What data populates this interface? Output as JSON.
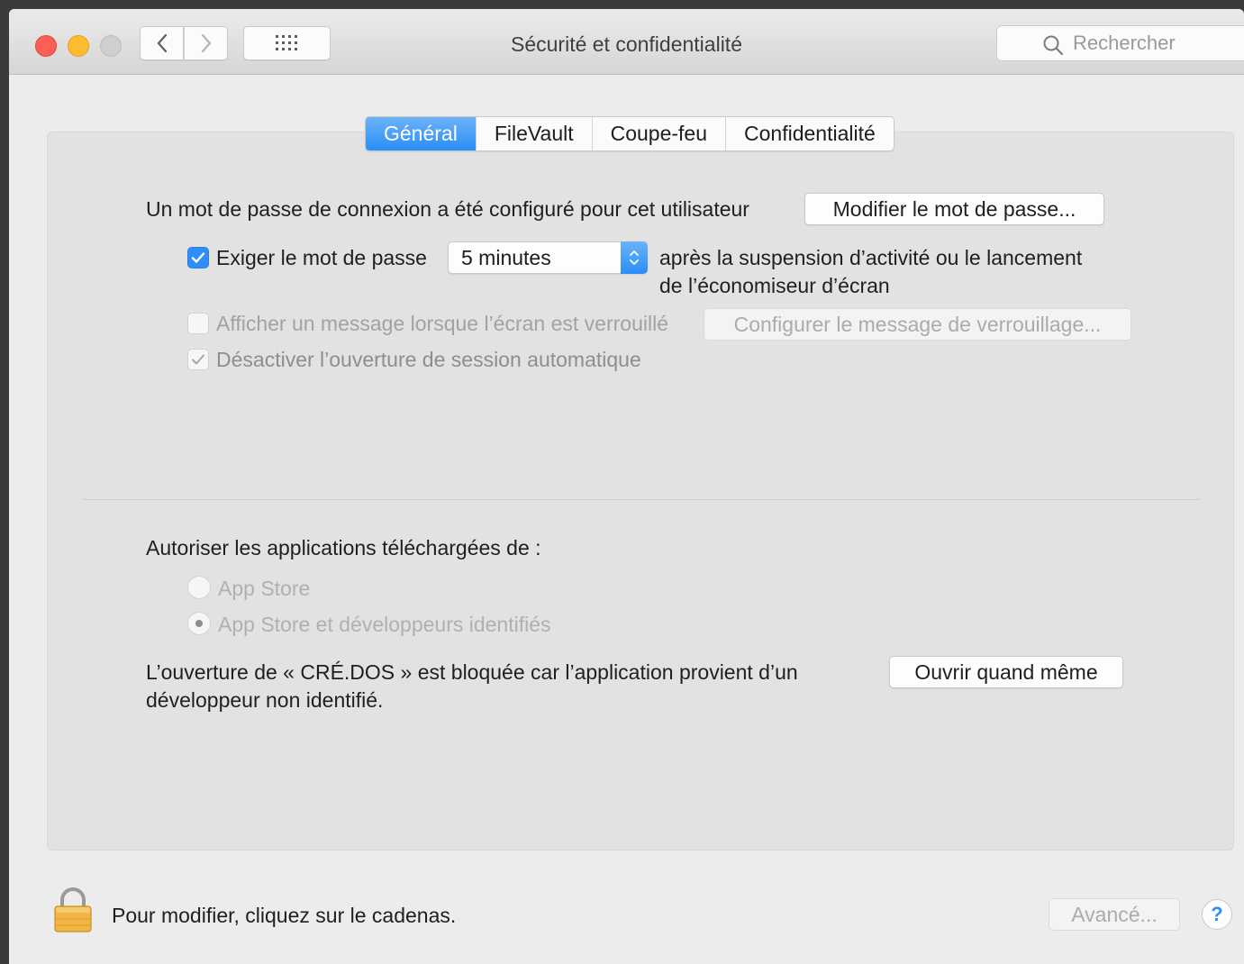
{
  "window": {
    "title": "Sécurité et confidentialité"
  },
  "search": {
    "placeholder": "Rechercher"
  },
  "tabs": [
    {
      "label": "Général",
      "active": true
    },
    {
      "label": "FileVault",
      "active": false
    },
    {
      "label": "Coupe-feu",
      "active": false
    },
    {
      "label": "Confidentialité",
      "active": false
    }
  ],
  "general": {
    "password_text": "Un mot de passe de connexion a été configuré pour cet utilisateur",
    "change_password_button": "Modifier le mot de passe...",
    "require_password_label": "Exiger le mot de passe",
    "require_password_checked": true,
    "require_password_delay": "5 minutes",
    "after_text_line1": "après la suspension d’activité ou le lancement",
    "after_text_line2": "de l’économiseur d’écran",
    "show_message_label": "Afficher un message lorsque l’écran est verrouillé",
    "show_message_checked": false,
    "configure_message_button": "Configurer le message de verrouillage...",
    "disable_autologin_label": "Désactiver l’ouverture de session automatique",
    "disable_autologin_checked": true
  },
  "downloads": {
    "heading": "Autoriser les applications téléchargées de :",
    "options": [
      {
        "label": "App Store",
        "selected": false
      },
      {
        "label": "App Store et développeurs identifiés",
        "selected": true
      }
    ],
    "blocked_line1": "L’ouverture de « CRÉ.DOS » est bloquée car l’application provient d’un",
    "blocked_line2": "développeur non identifié.",
    "open_anyway_button": "Ouvrir quand même"
  },
  "footer": {
    "lock_text": "Pour modifier, cliquez sur le cadenas.",
    "advanced_button": "Avancé...",
    "help_button": "?"
  },
  "colors": {
    "accent": "#2f8ef7",
    "close": "#fc5f57",
    "minimize": "#fdbb2e",
    "zoom": "#cfcfcf",
    "lock": "#f2b544"
  }
}
